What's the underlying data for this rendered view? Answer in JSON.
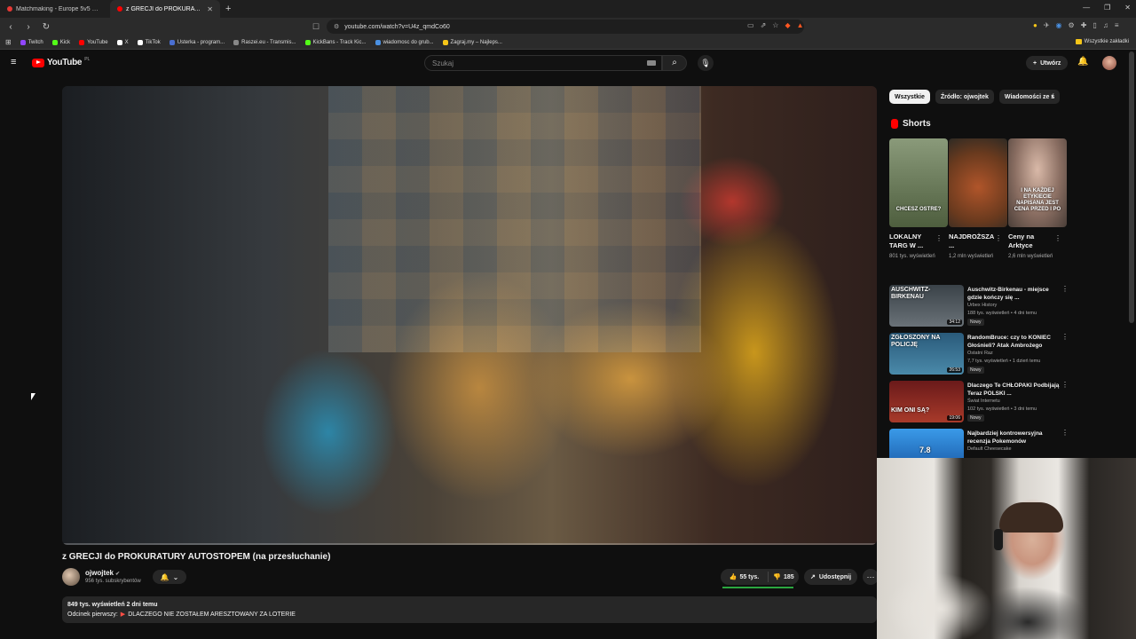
{
  "browser": {
    "tabs": [
      {
        "label": "Matchmaking - Europe 5v5 Queue",
        "active": false,
        "color": "#e53935"
      },
      {
        "label": "z GRECJI do PROKURATURY A",
        "active": true,
        "color": "#ff0000"
      }
    ],
    "url": "youtube.com/watch?v=U4z_qmdCo60",
    "bookmarks": [
      {
        "label": "Twitch",
        "color": "#9146ff"
      },
      {
        "label": "Kick",
        "color": "#53fc18"
      },
      {
        "label": "YouTube",
        "color": "#ff0000"
      },
      {
        "label": "X",
        "color": "#ffffff"
      },
      {
        "label": "TikTok",
        "color": "#ffffff"
      },
      {
        "label": "Usterka - program...",
        "color": "#4a6fd1"
      },
      {
        "label": "Raszei.eu - Transmis...",
        "color": "#888888"
      },
      {
        "label": "KickBans - Track Kic...",
        "color": "#53fc18"
      },
      {
        "label": "wiadomosc do grub...",
        "color": "#4a90e2"
      },
      {
        "label": "Zagraj.my – Najleps...",
        "color": "#f5c518"
      }
    ],
    "bookmarks_right": "Wszystkie zakładki"
  },
  "youtube": {
    "logo_text": "YouTube",
    "logo_region": "PL",
    "search_placeholder": "Szukaj",
    "create_label": "Utwórz"
  },
  "video": {
    "title": "z GRECJI do PROKURATURY AUTOSTOPEM (na przesłuchanie)",
    "channel": "ojwojtek",
    "subscribers": "956 tys. subskrybentów",
    "likes": "55 tys.",
    "dislikes": "185",
    "like_ratio": 0.997,
    "share_label": "Udostępnij",
    "views_date": "849 tys. wyświetleń  2 dni temu",
    "desc_prefix": "Odcinek pierwszy:",
    "desc_link": "DLACZEGO NIE ZOSTAŁEM ARESZTOWANY ZA LOTERIE",
    "progress": 0.0
  },
  "sidebar": {
    "chips": [
      {
        "label": "Wszystkie",
        "active": true
      },
      {
        "label": "Źródło: ojwojtek",
        "active": false
      },
      {
        "label": "Wiadomości ze ś",
        "active": false
      }
    ],
    "shorts_title": "Shorts",
    "shorts": [
      {
        "title": "LOKALNY TARG W ...",
        "views": "801 tys. wyświetleń",
        "caption": "CHCESZ OSTRE?",
        "bg": "#5a6b4a"
      },
      {
        "title": "NAJDROŻSZA ...",
        "views": "1,2 mln wyświetleń",
        "caption": "",
        "bg": "#8a5a2e"
      },
      {
        "title": "Ceny na Arktyce",
        "views": "2,6 mln wyświetleń",
        "caption": "I NA KAŻDEJ ETYKIECIE NAPISANA JEST CENA PRZED I PO",
        "bg": "#7a6e66"
      }
    ],
    "recommendations": [
      {
        "title": "Auschwitz-Birkenau - miejsce gdzie kończy się ...",
        "channel": "Urbex History",
        "meta": "188 tys. wyświetleń • 4 dni temu",
        "badge": "Nowy",
        "duration": "34:12",
        "thumb_text": "AUSCHWITZ-BIRKENAU",
        "bg": "#4a5258"
      },
      {
        "title": "RandomBruce: czy to KONIEC Głośnieli? Atak Ambrożego",
        "channel": "Ostatni Raz",
        "meta": "7,7 tys. wyświetleń • 1 dzień temu",
        "badge": "Nowy",
        "duration": "26:53",
        "thumb_text": "ZGŁOSZONY NA POLICJĘ",
        "bg": "#3a6a8a"
      },
      {
        "title": "Dlaczego Te CHŁOPAKI Podbijają Teraz POLSKI ...",
        "channel": "Świat Internetu",
        "meta": "102 tys. wyświetleń • 3 dni temu",
        "badge": "Nowy",
        "duration": "19:06",
        "thumb_text": "KIM ONI SĄ?",
        "bg": "#8a2a2a"
      },
      {
        "title": "Najbardziej kontrowersyjna recenzja Pokemonów",
        "channel": "Default Cheesecake",
        "meta": "",
        "badge": "",
        "duration": "",
        "thumb_text": "7.8",
        "bg": "#2a7ac8"
      }
    ]
  }
}
